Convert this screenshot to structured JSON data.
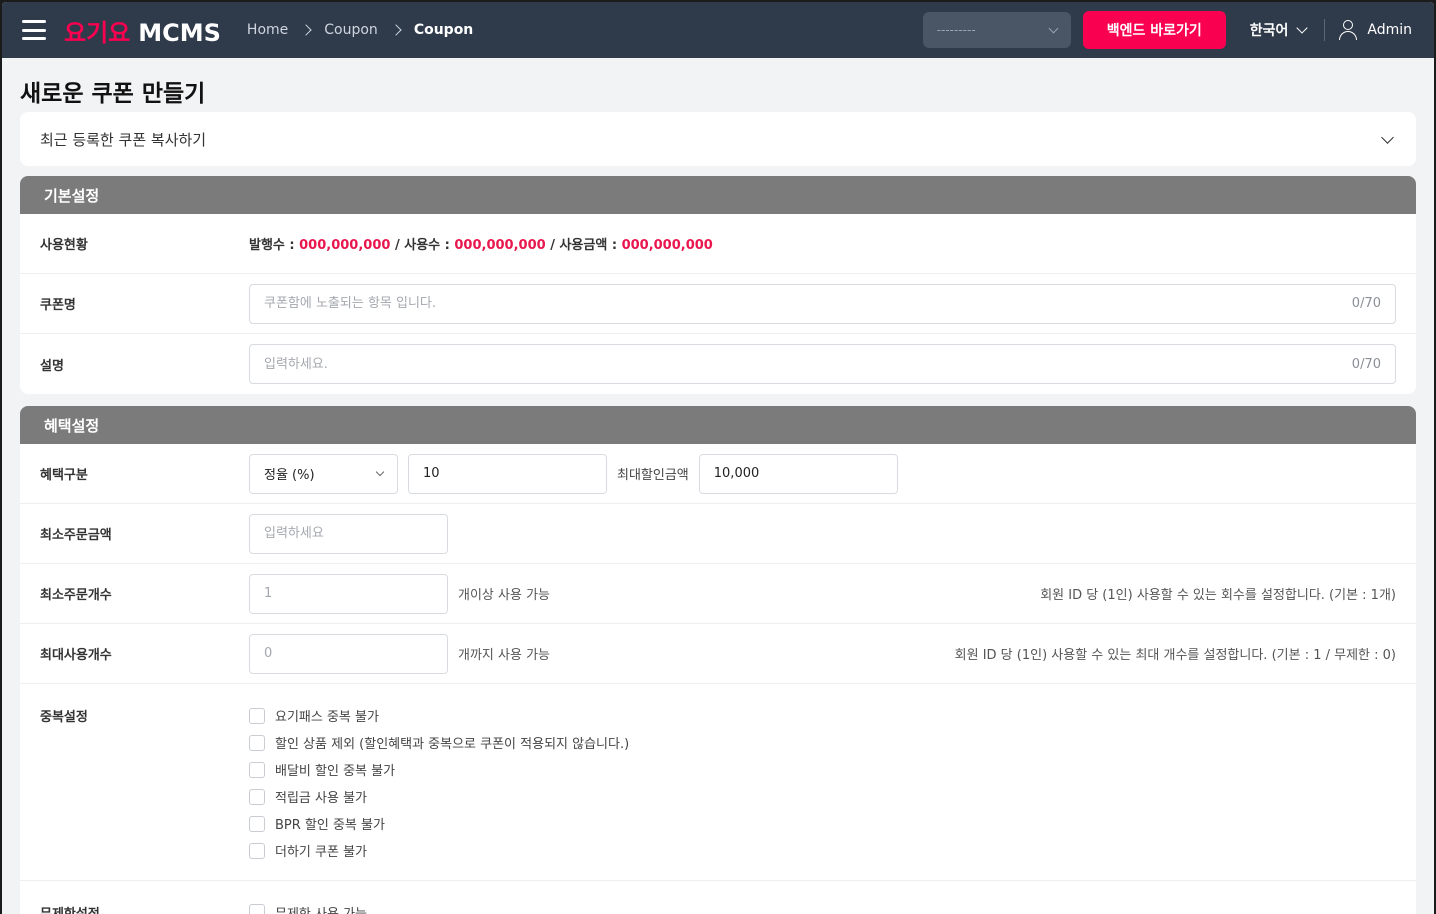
{
  "header": {
    "logo_red": "요기요",
    "logo_white": "MCMS",
    "breadcrumbs": [
      "Home",
      "Coupon",
      "Coupon"
    ],
    "store_select_placeholder": "---------",
    "backend_button": "백엔드 바로가기",
    "language": "한국어",
    "user": "Admin"
  },
  "page": {
    "title": "새로운 쿠폰 만들기",
    "copy_recent": "최근 등록한 쿠폰 복사하기"
  },
  "basic": {
    "heading": "기본설정",
    "usage_label": "사용현황",
    "issued_label": "발행수 : ",
    "issued_value": "000,000,000",
    "used_label": " / 사용수 : ",
    "used_value": "000,000,000",
    "amount_label": " / 사용금액 : ",
    "amount_value": "000,000,000",
    "coupon_name_label": "쿠폰명",
    "coupon_name_placeholder": "쿠폰함에 노출되는 항목 입니다.",
    "coupon_name_counter": "0/70",
    "desc_label": "설명",
    "desc_placeholder": "입력하세요.",
    "desc_counter": "0/70"
  },
  "benefit": {
    "heading": "혜택설정",
    "type_label": "혜택구분",
    "type_value": "정율 (%)",
    "rate_value": "10",
    "max_discount_label": "최대할인금액",
    "max_discount_value": "10,000",
    "min_order_amount_label": "최소주문금액",
    "min_order_amount_placeholder": "입력하세요",
    "min_order_count_label": "최소주문개수",
    "min_order_count_placeholder": "1",
    "min_order_count_suffix": "개이상 사용 가능",
    "min_order_count_hint": "회원 ID 당 (1인) 사용할 수 있는 회수를 설정합니다. (기본 : 1개)",
    "max_use_label": "최대사용개수",
    "max_use_placeholder": "0",
    "max_use_suffix": "개까지 사용 가능",
    "max_use_hint": "회원 ID 당 (1인) 사용할 수 있는 최대 개수를 설정합니다. (기본 : 1 / 무제한 : 0)",
    "dup_label": "중복설정",
    "dup_options": [
      "요기패스 중복 불가",
      "할인 상품 제외 (할인혜택과 중복으로 쿠폰이 적용되지 않습니다.)",
      "배달비 할인 중복 불가",
      "적립금 사용 불가",
      "BPR 할인 중복 불가",
      "더하기 쿠폰 불가"
    ],
    "unlimited_label": "무제한설정",
    "unlimited_option": "무제한 사용 가능"
  }
}
